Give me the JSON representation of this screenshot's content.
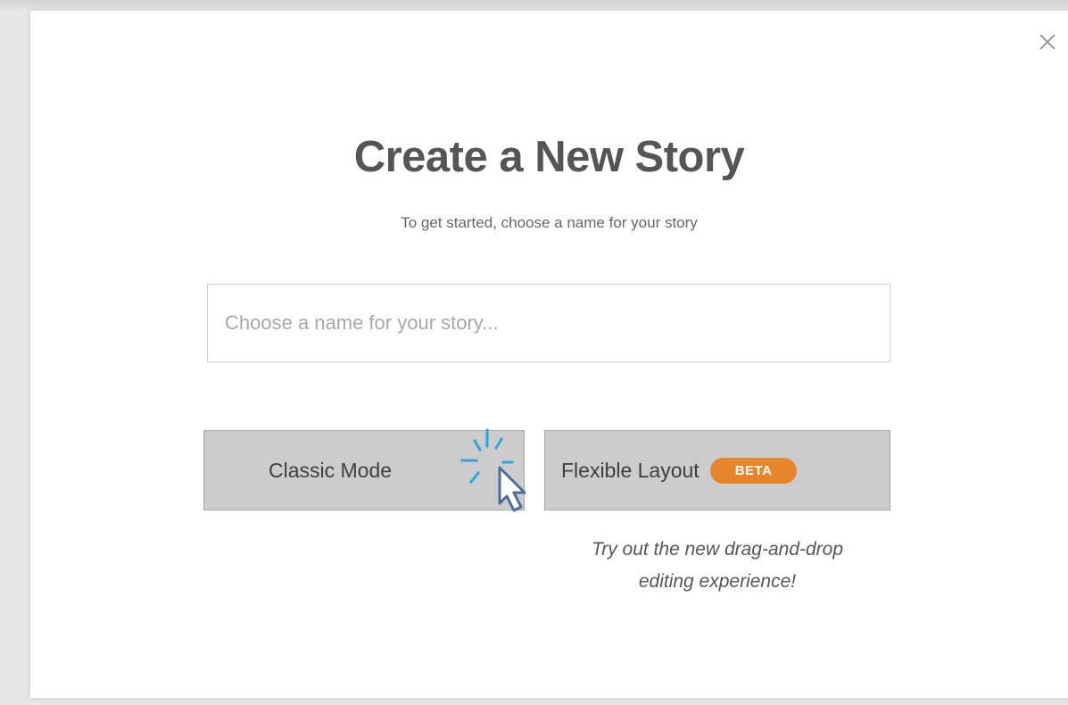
{
  "modal": {
    "title": "Create a New Story",
    "subtitle": "To get started, choose a name for your story",
    "close_icon": "close-icon"
  },
  "name_input": {
    "value": "",
    "placeholder": "Choose a name for your story..."
  },
  "buttons": {
    "classic_label": "Classic Mode",
    "flexible_label": "Flexible Layout",
    "flexible_badge": "BETA"
  },
  "hint": {
    "line1": "Try out the new drag-and-drop",
    "line2": "editing experience!"
  },
  "colors": {
    "badge": "#e6852a",
    "button_bg": "#cccccc",
    "click_indicator": "#29a8e0"
  },
  "cursor": {
    "icon": "mouse-pointer-click-icon"
  }
}
